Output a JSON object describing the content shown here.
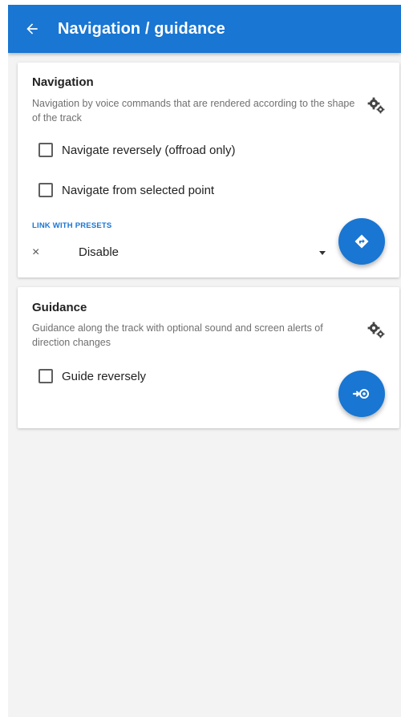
{
  "app_bar": {
    "title": "Navigation / guidance",
    "back_icon": "arrow-left-icon"
  },
  "navigation_card": {
    "title": "Navigation",
    "description": "Navigation by voice commands that are rendered according to the shape of the track",
    "settings_icon": "gear-settings-icon",
    "options": [
      {
        "label": "Navigate reversely (offroad only)",
        "checked": false
      },
      {
        "label": "Navigate from selected point",
        "checked": false
      }
    ],
    "presets_label": "LINK WITH PRESETS",
    "preset_clear_symbol": "×",
    "preset_value": "Disable",
    "fab_icon": "navigation-diamond-icon"
  },
  "guidance_card": {
    "title": "Guidance",
    "description": "Guidance along the track with optional sound and screen alerts of direction changes",
    "settings_icon": "gear-settings-icon",
    "options": [
      {
        "label": "Guide reversely",
        "checked": false
      }
    ],
    "fab_icon": "guidance-target-icon"
  },
  "colors": {
    "accent": "#1976d2",
    "background": "#f3f3f3",
    "card": "#ffffff"
  }
}
